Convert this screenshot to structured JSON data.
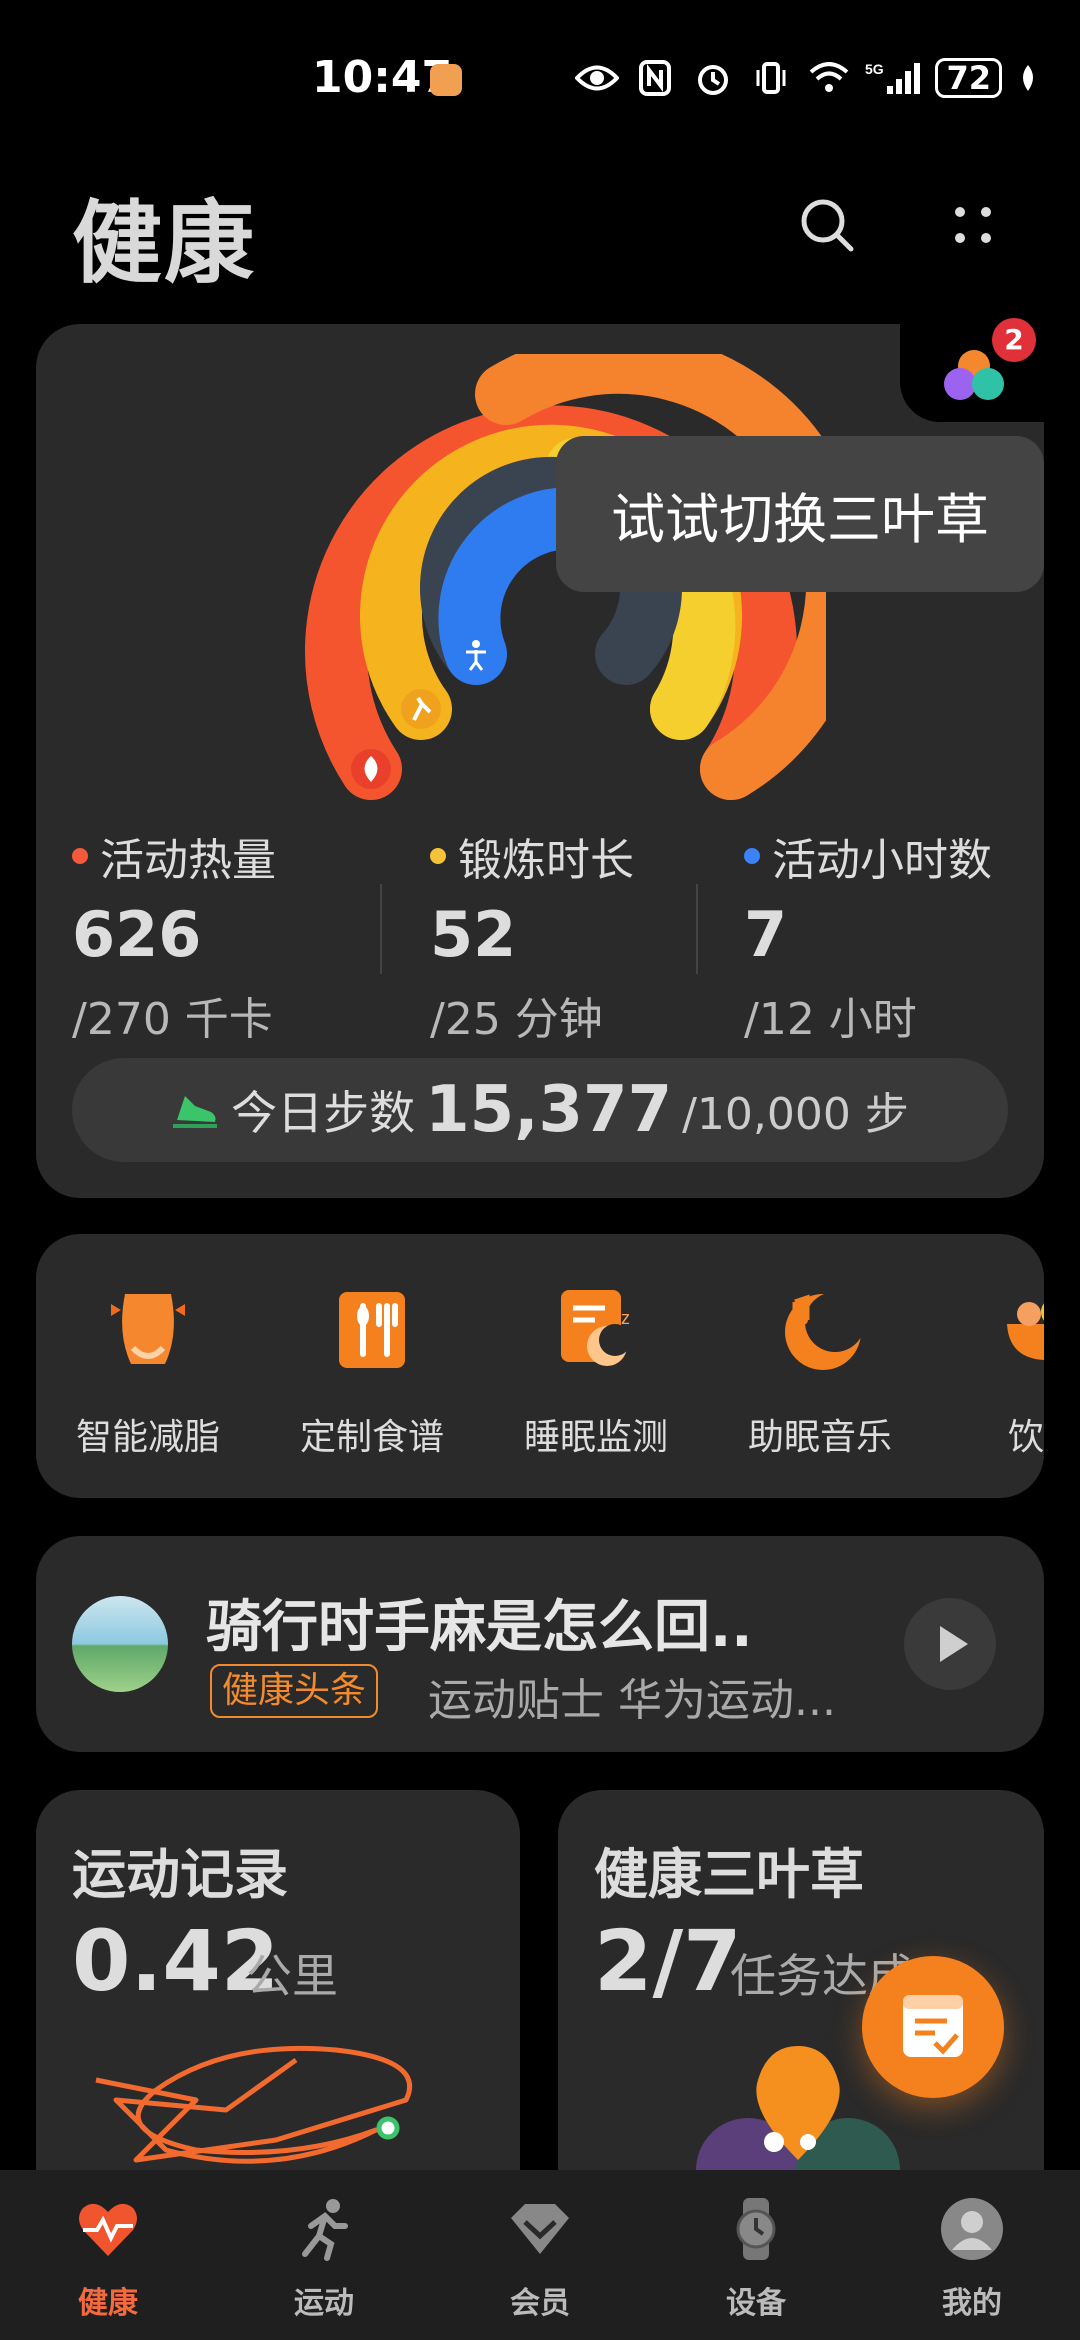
{
  "status_bar": {
    "time": "10:47",
    "network": "5G",
    "battery": "72"
  },
  "header": {
    "title": "健康"
  },
  "trefoil": {
    "badge_count": "2",
    "tooltip": "试试切换三叶草"
  },
  "activity": {
    "metrics": [
      {
        "label": "活动热量",
        "value": "626",
        "goal": "/270 千卡",
        "color": "#f25a3a"
      },
      {
        "label": "锻炼时长",
        "value": "52",
        "goal": "/25 分钟",
        "color": "#f5c23a"
      },
      {
        "label": "活动小时数",
        "value": "7",
        "goal": "/12 小时",
        "color": "#3a82f5"
      }
    ],
    "steps": {
      "label": "今日步数",
      "value": "15,377",
      "goal": "/10,000 步"
    }
  },
  "services": [
    {
      "name": "智能减脂",
      "icon": "body-icon"
    },
    {
      "name": "定制食谱",
      "icon": "recipe-icon"
    },
    {
      "name": "睡眠监测",
      "icon": "sleep-icon"
    },
    {
      "name": "助眠音乐",
      "icon": "music-moon-icon"
    },
    {
      "name": "饮食",
      "icon": "food-bowl-icon"
    }
  ],
  "news": {
    "title": "骑行时手麻是怎么回..",
    "tag": "健康头条",
    "meta": "运动贴士 华为运动..."
  },
  "exercise_record": {
    "title": "运动记录",
    "value": "0.42",
    "unit": "公里"
  },
  "trefoil_card": {
    "title": "健康三叶草",
    "value": "2/7",
    "unit": "任务达成"
  },
  "nav": [
    {
      "label": "健康",
      "icon": "heart-pulse-icon",
      "active": true
    },
    {
      "label": "运动",
      "icon": "running-icon",
      "active": false
    },
    {
      "label": "会员",
      "icon": "diamond-icon",
      "active": false
    },
    {
      "label": "设备",
      "icon": "watch-icon",
      "active": false
    },
    {
      "label": "我的",
      "icon": "profile-icon",
      "active": false
    }
  ],
  "colors": {
    "accent": "#f5801e",
    "calorie": "#f25a3a",
    "exercise": "#f5c23a",
    "hours": "#3a82f5"
  }
}
